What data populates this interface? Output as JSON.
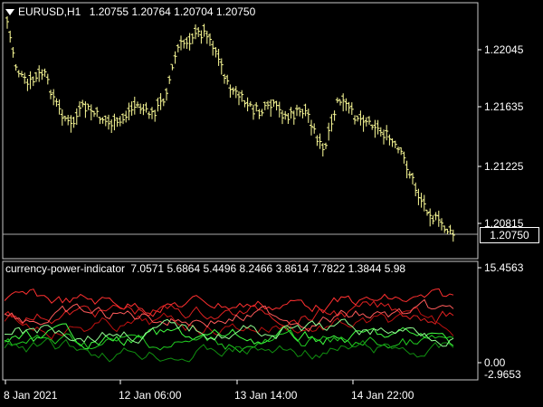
{
  "chart": {
    "symbol_label": "EURUSD,H1",
    "ohlc": [
      "1.20755",
      "1.20764",
      "1.20704",
      "1.20750"
    ],
    "price_ticks": [
      "1.22045",
      "1.21635",
      "1.21225",
      "1.20815"
    ],
    "current_price": "1.20750",
    "bar_color": "#ffff99",
    "time_ticks": [
      "8 Jan 2021",
      "12 Jan 06:00",
      "13 Jan 14:00",
      "14 Jan 22:00"
    ]
  },
  "indicator": {
    "name": "currency-power-indicator",
    "values": [
      "7.0571",
      "5.6864",
      "5.4496",
      "8.2466",
      "3.8614",
      "7.7822",
      "1.3844",
      "5.98"
    ],
    "scale_top": "15.4563",
    "scale_zero": "0.00",
    "scale_bottom": "-2.9653",
    "colors": [
      "#ff3030",
      "#dd2020",
      "#bb1010",
      "#ff5a5a",
      "#40ff40",
      "#20cc20",
      "#109010",
      "#90ff90"
    ]
  }
}
